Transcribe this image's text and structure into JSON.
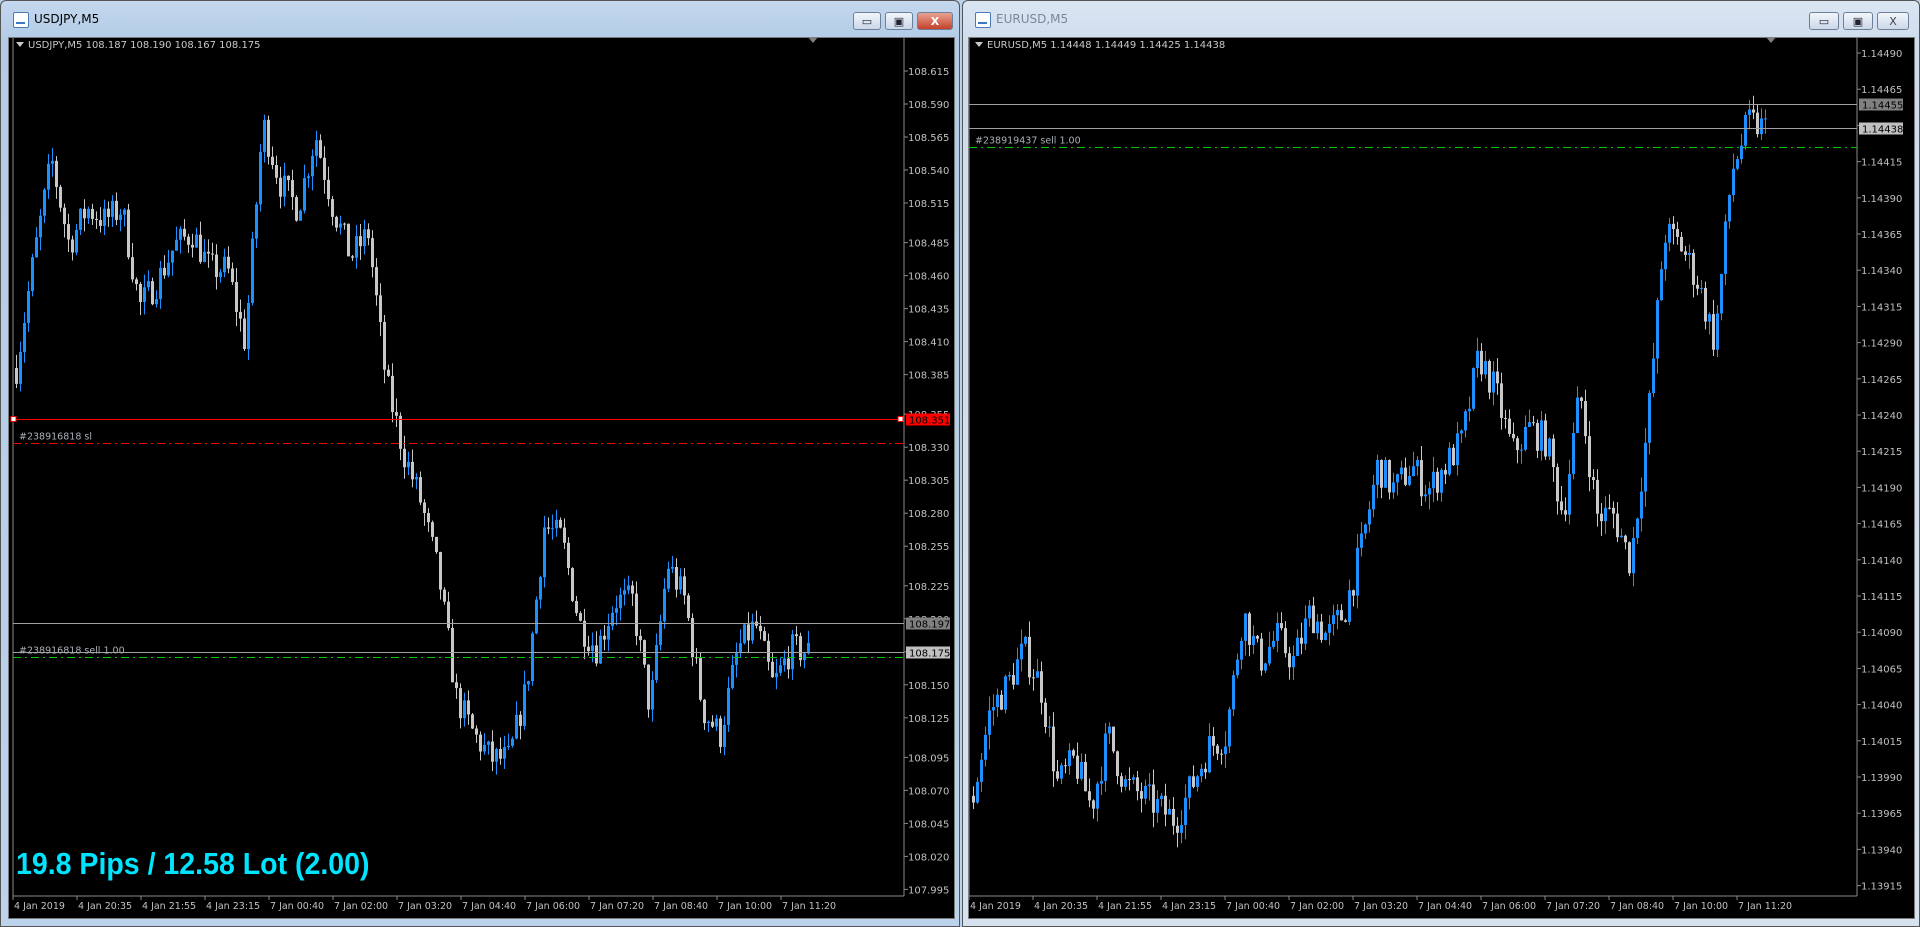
{
  "colors": {
    "bull": "#1e8fff",
    "bear": "#c8c8c8",
    "axis_text": "#c0c0c0",
    "grid_line": "#a0a0a0",
    "stop_loss": "#ff0000",
    "order": "#00c800",
    "bid": "#909090",
    "ask": "#c0c0c0",
    "info_text": "#00e5ff"
  },
  "windows": [
    {
      "title": "USDJPY,M5",
      "state": "active",
      "ohlc_label": "USDJPY,M5  108.187 108.190 108.167 108.175",
      "buttons": {
        "minimize": "▭",
        "maximize": "▣",
        "close": "X"
      },
      "price_ticks": [
        "108.615",
        "108.590",
        "108.565",
        "108.540",
        "108.515",
        "108.485",
        "108.460",
        "108.435",
        "108.410",
        "108.385",
        "108.355",
        "108.330",
        "108.305",
        "108.280",
        "108.255",
        "108.225",
        "108.200",
        "108.175",
        "108.150",
        "108.125",
        "108.095",
        "108.070",
        "108.045",
        "108.020",
        "107.995"
      ],
      "time_labels": [
        "4 Jan 2019",
        "4 Jan 20:35",
        "4 Jan 21:55",
        "4 Jan 23:15",
        "7 Jan 00:40",
        "7 Jan 02:00",
        "7 Jan 03:20",
        "7 Jan 04:40",
        "7 Jan 06:00",
        "7 Jan 07:20",
        "7 Jan 08:40",
        "7 Jan 10:00",
        "7 Jan 11:20"
      ],
      "levels": [
        {
          "type": "stop-loss-line",
          "price": 108.351,
          "label": "108.351",
          "style": "solid",
          "color": "#ff0000",
          "tag_bg": "#ff0000",
          "tag_fg": "#000000"
        },
        {
          "type": "sl-order-line",
          "price": 108.333,
          "text": "#238916818 sl",
          "style": "dashdot",
          "color": "#ff0000"
        },
        {
          "type": "ask-line",
          "price": 108.197,
          "label": "108.197",
          "style": "solid",
          "color": "#a0a0a0",
          "tag_bg": "#808080",
          "tag_fg": "#000000"
        },
        {
          "type": "bid-line",
          "price": 108.175,
          "label": "108.175",
          "style": "solid",
          "color": "#a0a0a0",
          "tag_bg": "#c0c0c0",
          "tag_fg": "#000000"
        },
        {
          "type": "sell-order-line",
          "price": 108.171,
          "text": "#238916818 sell 1.00",
          "style": "dashdot",
          "color": "#00c800"
        }
      ],
      "info_text": "19.8 Pips / 12.58 Lot (2.00)",
      "chart_data": {
        "type": "candlestick",
        "symbol": "USDJPY",
        "timeframe": "M5",
        "ylim": [
          107.995,
          108.615
        ],
        "close_path": [
          108.39,
          108.474,
          108.548,
          108.483,
          108.511,
          108.502,
          108.511,
          108.437,
          108.455,
          108.483,
          108.492,
          108.465,
          108.465,
          108.409,
          108.576,
          108.53,
          108.511,
          108.567,
          108.511,
          108.474,
          108.492,
          108.38,
          108.326,
          108.288,
          108.233,
          108.14,
          108.112,
          108.094,
          108.094,
          108.149,
          108.27,
          108.261,
          108.196,
          108.177,
          108.214,
          108.214,
          108.131,
          108.242,
          108.214,
          108.131,
          108.112,
          108.177,
          108.196,
          108.149,
          108.177,
          108.175
        ]
      }
    },
    {
      "title": "EURUSD,M5",
      "state": "inactive",
      "ohlc_label": "EURUSD,M5  1.14448 1.14449 1.14425 1.14438",
      "buttons": {
        "minimize": "▭",
        "maximize": "▣",
        "close": "X"
      },
      "price_ticks": [
        "1.14490",
        "1.14465",
        "1.14440",
        "1.14415",
        "1.14390",
        "1.14365",
        "1.14340",
        "1.14315",
        "1.14290",
        "1.14265",
        "1.14240",
        "1.14215",
        "1.14190",
        "1.14165",
        "1.14140",
        "1.14115",
        "1.14090",
        "1.14065",
        "1.14040",
        "1.14015",
        "1.13990",
        "1.13965",
        "1.13940",
        "1.13915"
      ],
      "time_labels": [
        "4 Jan 2019",
        "4 Jan 20:35",
        "4 Jan 21:55",
        "4 Jan 23:15",
        "7 Jan 00:40",
        "7 Jan 02:00",
        "7 Jan 03:20",
        "7 Jan 04:40",
        "7 Jan 06:00",
        "7 Jan 07:20",
        "7 Jan 08:40",
        "7 Jan 10:00",
        "7 Jan 11:20"
      ],
      "levels": [
        {
          "type": "ask-line",
          "price": 1.14455,
          "label": "1.14455",
          "style": "solid",
          "color": "#a0a0a0",
          "tag_bg": "#808080",
          "tag_fg": "#000000"
        },
        {
          "type": "bid-line",
          "price": 1.14438,
          "label": "1.14438",
          "style": "solid",
          "color": "#a0a0a0",
          "tag_bg": "#c0c0c0",
          "tag_fg": "#000000"
        },
        {
          "type": "sell-order-line",
          "price": 1.14425,
          "text": "#238919437 sell 1.00",
          "style": "dashdot",
          "color": "#00c800"
        }
      ],
      "chart_data": {
        "type": "candlestick",
        "symbol": "EURUSD",
        "timeframe": "M5",
        "ylim": [
          1.13915,
          1.1449
        ],
        "close_path": [
          1.13977,
          1.14036,
          1.14053,
          1.14078,
          1.14053,
          1.13985,
          1.14002,
          1.13969,
          1.14019,
          1.13985,
          1.13977,
          1.13969,
          1.1396,
          1.13985,
          1.14011,
          1.14019,
          1.14104,
          1.1407,
          1.14087,
          1.1407,
          1.14104,
          1.14087,
          1.14104,
          1.14146,
          1.14205,
          1.14188,
          1.14205,
          1.14188,
          1.14205,
          1.14222,
          1.14281,
          1.14256,
          1.14214,
          1.14231,
          1.14222,
          1.14171,
          1.14256,
          1.14171,
          1.14171,
          1.14138,
          1.14231,
          1.14366,
          1.14357,
          1.14332,
          1.1429,
          1.14408,
          1.14442,
          1.14438
        ]
      }
    }
  ]
}
